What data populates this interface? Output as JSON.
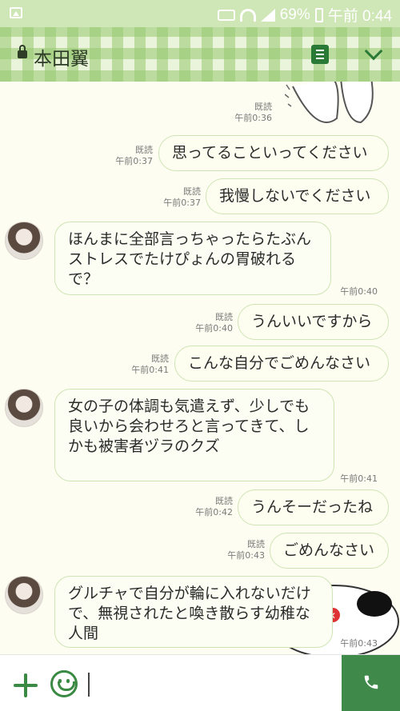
{
  "status_bar": {
    "battery": "69%",
    "time": "午前 0:44"
  },
  "header": {
    "contact_name": "本田翼"
  },
  "messages": [
    {
      "type": "sent",
      "text": "思ってることいってください",
      "read": "既読",
      "time": "午前0:37"
    },
    {
      "type": "sent",
      "text": "我慢しないでください",
      "read": "既読",
      "time": "午前0:37"
    },
    {
      "type": "received",
      "text": "ほんまに全部言っちゃったらたぶんストレスでたけぴょんの胃破れるで？",
      "time": "午前0:40"
    },
    {
      "type": "sent",
      "text": "うんいいですから",
      "read": "既読",
      "time": "午前0:40"
    },
    {
      "type": "sent",
      "text": "こんな自分でごめんなさい",
      "read": "既読",
      "time": "午前0:41"
    },
    {
      "type": "received",
      "text": "女の子の体調も気遣えず、少しでも良いから会わせろと言ってきて、しかも被害者ヅラのクズ",
      "time": "午前0:41"
    },
    {
      "type": "sent",
      "text": "うんそーだったね",
      "read": "既読",
      "time": "午前0:42"
    },
    {
      "type": "sent",
      "text": "ごめんなさい",
      "read": "既読",
      "time": "午前0:43"
    },
    {
      "type": "received",
      "text": "グルチャで自分が輪に入れないだけで、無視されたと喚き散らす幼稚な人間",
      "time": "午前0:43"
    }
  ],
  "sticker_meta": {
    "read": "既読",
    "time": "午前0:36"
  },
  "colors": {
    "accent": "#3f8a4a",
    "bubble_border": "#cfe4b4",
    "header_check": "#96c86e"
  }
}
